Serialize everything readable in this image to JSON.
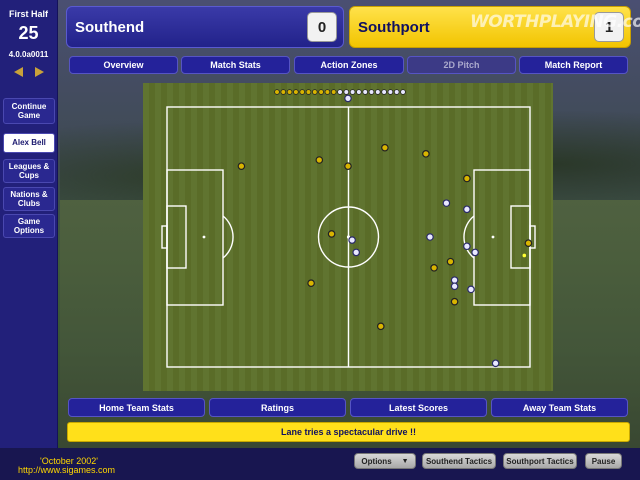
{
  "sidebar": {
    "period": "First Half",
    "minute": "25",
    "version": "4.0.0a0011",
    "buttons": {
      "continue": "Continue Game",
      "manager": "Alex Bell",
      "leagues": "Leagues & Cups",
      "nations": "Nations & Clubs",
      "options": "Game Options"
    }
  },
  "score": {
    "home_team": "Southend",
    "home_goals": "0",
    "away_team": "Southport",
    "away_goals": "1",
    "watermark": "WORTHPLAYING.com"
  },
  "tabs": [
    "Overview",
    "Match Stats",
    "Action Zones",
    "2D Pitch",
    "Match Report"
  ],
  "active_tab": "2D Pitch",
  "pitch": {
    "colors": {
      "grass": "#5c6e2a",
      "home_kit": "#e8e8ff",
      "away_kit": "#d8b400",
      "ball": "#ffff33"
    },
    "home_players": [
      [
        0.5,
        0.05
      ],
      [
        0.74,
        0.39
      ],
      [
        0.79,
        0.41
      ],
      [
        0.7,
        0.5
      ],
      [
        0.79,
        0.53
      ],
      [
        0.81,
        0.55
      ],
      [
        0.76,
        0.64
      ],
      [
        0.76,
        0.66
      ],
      [
        0.8,
        0.67
      ],
      [
        0.51,
        0.51
      ],
      [
        0.52,
        0.55
      ],
      [
        0.86,
        0.91
      ]
    ],
    "away_players": [
      [
        0.24,
        0.27
      ],
      [
        0.43,
        0.25
      ],
      [
        0.5,
        0.27
      ],
      [
        0.59,
        0.21
      ],
      [
        0.69,
        0.23
      ],
      [
        0.79,
        0.31
      ],
      [
        0.46,
        0.49
      ],
      [
        0.71,
        0.6
      ],
      [
        0.75,
        0.58
      ],
      [
        0.41,
        0.65
      ],
      [
        0.76,
        0.71
      ],
      [
        0.58,
        0.79
      ],
      [
        0.94,
        0.52
      ]
    ],
    "ball": [
      0.93,
      0.56
    ]
  },
  "bottom_buttons": [
    "Home Team Stats",
    "Ratings",
    "Latest Scores",
    "Away Team Stats"
  ],
  "commentary": "Lane tries a spectacular drive !!",
  "footer": {
    "date": "'October 2002'",
    "url": "http://www.sigames.com",
    "options": "Options",
    "home_tactics": "Southend Tactics",
    "away_tactics": "Southport Tactics",
    "pause": "Pause"
  }
}
